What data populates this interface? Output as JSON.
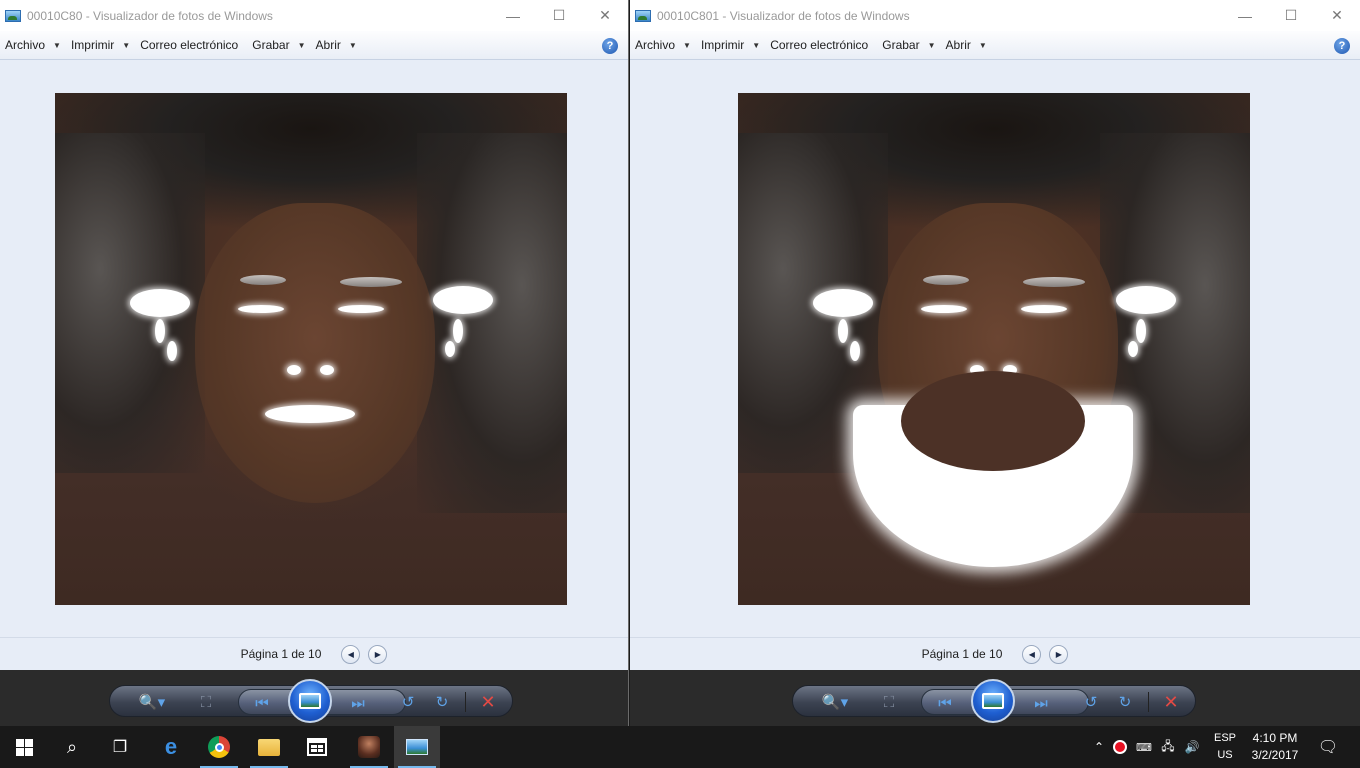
{
  "windows": [
    {
      "title": "00010C80 - Visualizador de fotos de Windows",
      "menu": [
        "Archivo",
        "Imprimir",
        "Correo electrónico",
        "Grabar",
        "Abrir"
      ],
      "page_label": "Página 1 de 10",
      "has_beard": false
    },
    {
      "title": "00010C801 - Visualizador de fotos de Windows",
      "menu": [
        "Archivo",
        "Imprimir",
        "Correo electrónico",
        "Grabar",
        "Abrir"
      ],
      "page_label": "Página 1 de 10",
      "has_beard": true
    }
  ],
  "caption_glyphs": {
    "minimize": "—",
    "maximize": "☐",
    "close": "✕"
  },
  "help_glyph": "?",
  "controls": {
    "zoom_icon": "magnifier-icon",
    "fit_icon": "actual-size-icon",
    "prev_icon": "previous-icon",
    "slideshow_icon": "slideshow-icon",
    "next_icon": "next-icon",
    "rotate_ccw_icon": "rotate-left-icon",
    "rotate_cw_icon": "rotate-right-icon",
    "delete_icon": "delete-icon"
  },
  "taskbar": {
    "apps": [
      "start",
      "search",
      "task-view",
      "edge",
      "chrome",
      "file-explorer",
      "store",
      "game",
      "photo-viewer"
    ],
    "language_top": "ESP",
    "language_bottom": "US",
    "time": "4:10 PM",
    "date": "3/2/2017"
  },
  "colors": {
    "accent": "#76b9ed",
    "delete": "#e24a45",
    "record": "#e81123"
  }
}
